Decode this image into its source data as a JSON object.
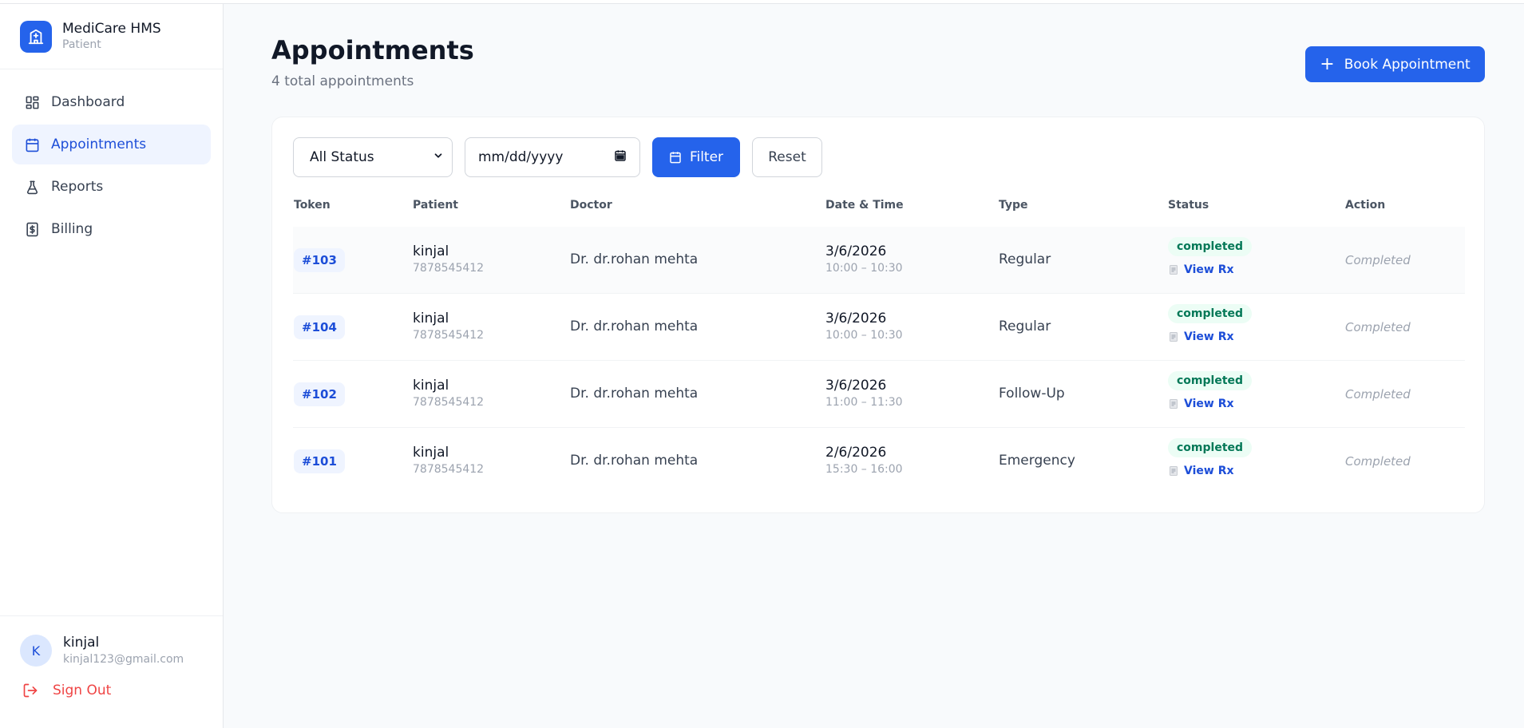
{
  "brand": {
    "name": "MediCare HMS",
    "role": "Patient"
  },
  "nav": [
    {
      "label": "Dashboard",
      "icon": "dashboard-icon"
    },
    {
      "label": "Appointments",
      "icon": "calendar-icon",
      "active": true
    },
    {
      "label": "Reports",
      "icon": "flask-icon"
    },
    {
      "label": "Billing",
      "icon": "receipt-icon"
    }
  ],
  "user": {
    "initial": "K",
    "name": "kinjal",
    "email": "kinjal123@gmail.com",
    "signout_label": "Sign Out"
  },
  "page": {
    "title": "Appointments",
    "subtitle": "4 total appointments",
    "book_label": "Book Appointment"
  },
  "filters": {
    "status_value": "All Status",
    "date_placeholder": "mm/dd/yyyy",
    "filter_label": "Filter",
    "reset_label": "Reset"
  },
  "table": {
    "headers": [
      "Token",
      "Patient",
      "Doctor",
      "Date & Time",
      "Type",
      "Status",
      "Action"
    ],
    "rows": [
      {
        "token": "#103",
        "patient": "kinjal",
        "phone": "7878545412",
        "doctor": "Dr. dr.rohan mehta",
        "date": "3/6/2026",
        "time": "10:00 – 10:30",
        "type": "Regular",
        "status": "completed",
        "rx": "View Rx",
        "action": "Completed"
      },
      {
        "token": "#104",
        "patient": "kinjal",
        "phone": "7878545412",
        "doctor": "Dr. dr.rohan mehta",
        "date": "3/6/2026",
        "time": "10:00 – 10:30",
        "type": "Regular",
        "status": "completed",
        "rx": "View Rx",
        "action": "Completed"
      },
      {
        "token": "#102",
        "patient": "kinjal",
        "phone": "7878545412",
        "doctor": "Dr. dr.rohan mehta",
        "date": "3/6/2026",
        "time": "11:00 – 11:30",
        "type": "Follow-Up",
        "status": "completed",
        "rx": "View Rx",
        "action": "Completed"
      },
      {
        "token": "#101",
        "patient": "kinjal",
        "phone": "7878545412",
        "doctor": "Dr. dr.rohan mehta",
        "date": "2/6/2026",
        "time": "15:30 – 16:00",
        "type": "Emergency",
        "status": "completed",
        "rx": "View Rx",
        "action": "Completed"
      }
    ]
  },
  "colors": {
    "primary": "#2563eb",
    "success_bg": "#ecfdf5",
    "success_text": "#047857",
    "danger": "#ef4444"
  }
}
